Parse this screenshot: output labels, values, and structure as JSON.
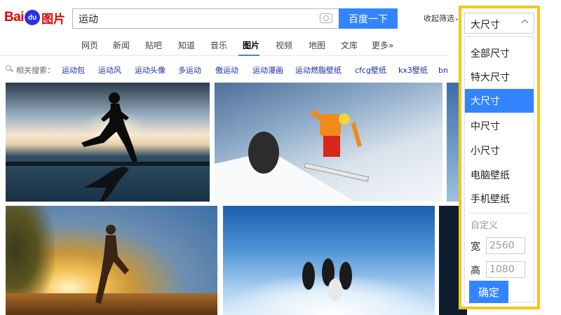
{
  "logo": {
    "text_left": "Bai",
    "text_paw": "du",
    "text_right": "图片"
  },
  "search": {
    "query": "运动",
    "button": "百度一下"
  },
  "filter": {
    "collapse_label": "收起筛选",
    "collapse_arrow": "▸"
  },
  "tabs": [
    {
      "label": "网页"
    },
    {
      "label": "新闻"
    },
    {
      "label": "贴吧"
    },
    {
      "label": "知道"
    },
    {
      "label": "音乐"
    },
    {
      "label": "图片",
      "active": true
    },
    {
      "label": "视频"
    },
    {
      "label": "地图"
    },
    {
      "label": "文库"
    },
    {
      "label": "更多»"
    }
  ],
  "related": {
    "label": "相关搜索：",
    "items": [
      "运动包",
      "运动风",
      "运动头像",
      "多运动",
      "傲运动",
      "运动漫画",
      "运动燃脂壁纸",
      "cfcg壁纸",
      "kx3壁纸",
      "bnnn壁纸"
    ]
  },
  "size_dropdown": {
    "current": "大尺寸",
    "options": [
      {
        "label": "全部尺寸"
      },
      {
        "label": "特大尺寸"
      },
      {
        "label": "大尺寸",
        "selected": true
      },
      {
        "label": "中尺寸"
      },
      {
        "label": "小尺寸"
      },
      {
        "label": "电脑壁纸"
      },
      {
        "label": "手机壁纸"
      }
    ],
    "custom_label": "自定义",
    "width_label": "宽",
    "width_value": "2560",
    "height_label": "高",
    "height_value": "1080",
    "confirm": "确定"
  },
  "colors": {
    "accent": "#3385ff",
    "highlight_border": "#f6c517",
    "logo_red": "#e10602",
    "logo_blue": "#2932e1"
  }
}
